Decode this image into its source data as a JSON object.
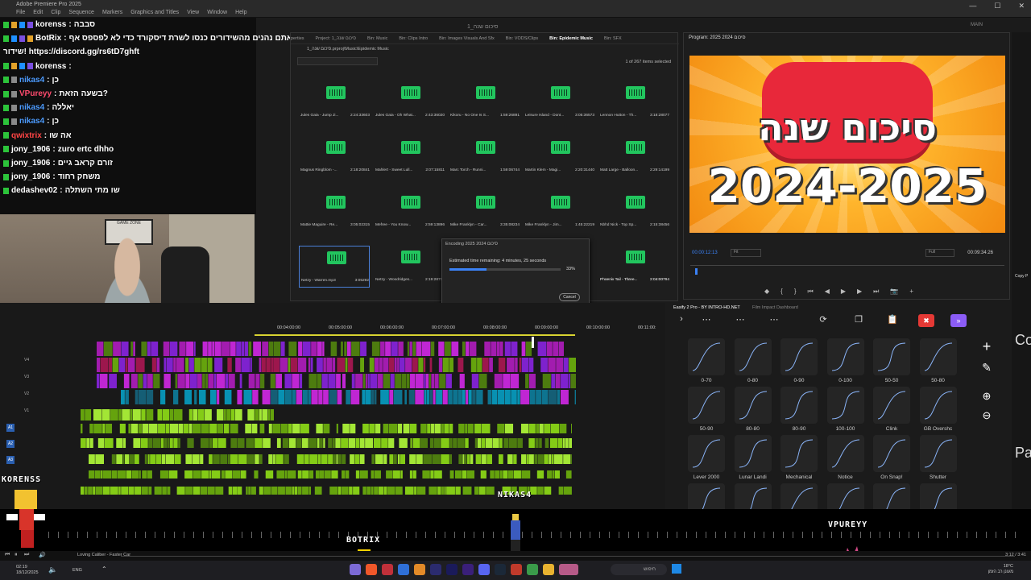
{
  "titlebar": {
    "app": "Adobe Premiere Pro 2025",
    "menus": [
      "File",
      "Edit",
      "Clip",
      "Sequence",
      "Markers",
      "Graphics and Titles",
      "View",
      "Window",
      "Help"
    ],
    "sequence_title": "סיכום שנה_1",
    "workspace": "MAIN"
  },
  "chat": [
    {
      "user": "korenss",
      "color": "#ffffff",
      "text": "סבבה",
      "badges": [
        "green",
        "orange",
        "blue",
        "purple"
      ]
    },
    {
      "user": "BotRix",
      "color": "#ffffff",
      "text": "אם אתם נהנים מהשידורים כנסו לשרת דיסקורד כדי לא לפספס אף",
      "badges": [
        "green",
        "blue",
        "purple",
        "orange"
      ]
    },
    {
      "user": "",
      "color": "#ffffff",
      "text": "שידור! https://discord.gg/rs6tD7ghft",
      "badges": []
    },
    {
      "user": "korenss",
      "color": "#ffffff",
      "text": "",
      "badges": [
        "green",
        "orange",
        "blue",
        "purple"
      ]
    },
    {
      "user": "nikas4",
      "color": "#4c9bff",
      "text": "כן",
      "badges": [
        "green",
        "gray"
      ]
    },
    {
      "user": "VPureyy",
      "color": "#ff4b6e",
      "text": "בשעה הזאת?",
      "badges": [
        "green",
        "gray"
      ]
    },
    {
      "user": "nikas4",
      "color": "#4c9bff",
      "text": "יאללה",
      "badges": [
        "green",
        "gray"
      ]
    },
    {
      "user": "nikas4",
      "color": "#4c9bff",
      "text": "כן",
      "badges": [
        "green",
        "gray"
      ]
    },
    {
      "user": "qwixtrix",
      "color": "#ff4545",
      "text": "אה שו",
      "badges": [
        "green"
      ]
    },
    {
      "user": "jony_1906",
      "color": "#ffffff",
      "text": "zuro ertc dhho",
      "badges": [
        "green"
      ]
    },
    {
      "user": "jony_1906",
      "color": "#ffffff",
      "text": "זורם קראב גיים",
      "badges": [
        "green"
      ]
    },
    {
      "user": "jony_1906",
      "color": "#ffffff",
      "text": "משחק רחוד",
      "badges": [
        "green"
      ]
    },
    {
      "user": "dedashev02",
      "color": "#ffffff",
      "text": "שו מתי השתלה",
      "badges": [
        "green"
      ]
    }
  ],
  "cam": {
    "sign": "GAME ZONE"
  },
  "project": {
    "tabs": [
      "perties",
      "Project: 1_סיכום שנה",
      "Bin: Music",
      "Bin: Clips Intro",
      "Bin: Images Visuals And Sfx",
      "Bin: VODS/Clips",
      "Bin: Epidemic Music",
      "Bin: SFX"
    ],
    "active_tab": "Bin: Epidemic Music",
    "path": "1_סיכום שנה.prproj\\Music\\Epidemic Music",
    "items_count": "1 of 267 items selected",
    "clips": [
      {
        "name": "Jules Gaia - Jump Ji...",
        "dur": "2:24:33603"
      },
      {
        "name": "Jules Gaia - Oh What...",
        "dur": "2:43:36020"
      },
      {
        "name": "Kikoru - No One Is S...",
        "dur": "1:59:26891"
      },
      {
        "name": "Leisure Island - Dont...",
        "dur": "3:05:36573"
      },
      {
        "name": "Lennon Hutton - Th...",
        "dur": "3:18:28077"
      },
      {
        "name": "Magnus Ringblom -...",
        "dur": "2:18:20841"
      },
      {
        "name": "Mahlert - Sweet Lull...",
        "dur": "2:07:15811"
      },
      {
        "name": "Marc Torch - Runni...",
        "dur": "1:59:06744"
      },
      {
        "name": "Martin Klem - Magi...",
        "dur": "2:20:31440"
      },
      {
        "name": "Matt Large - Balloon...",
        "dur": "2:29:14199"
      },
      {
        "name": "Mattie Maguire - Re...",
        "dur": "3:05:02315"
      },
      {
        "name": "Mefree - You Know...",
        "dur": "2:59:13896"
      },
      {
        "name": "Mike Franklyn - Car...",
        "dur": "3:35:08234"
      },
      {
        "name": "Mike Franklyn - Jim...",
        "dur": "1:45:22219"
      },
      {
        "name": "Nbhd Nick - Top Sp...",
        "dur": "2:15:38456"
      },
      {
        "name": "Netzy - Warren.mp3",
        "dur": "3:05292"
      },
      {
        "name": "Netzy - Woodridges...",
        "dur": "2:19:28755"
      },
      {
        "name": "",
        "dur": ""
      },
      {
        "name": "",
        "dur": "4"
      },
      {
        "name": "Phoenix Tail - Three...",
        "dur": "2:04:00794"
      }
    ]
  },
  "encoding": {
    "title": "Encoding 2025 2024 סיכום",
    "estimated": "Estimated time remaining: 4 minutes, 25 seconds",
    "percent_label": "33%",
    "progress": 0.33,
    "cancel": "Cancel"
  },
  "program": {
    "title": "Program: 2025 2024 סיכום",
    "thumb_heb": "סיכום שנה",
    "thumb_year": "2024-2025",
    "current_time": "00:00:12:13",
    "fit": "Fit",
    "full": "Full",
    "duration": "00:09:34:26"
  },
  "timeline": {
    "ruler": [
      "00:04:00:00",
      "00:05:00:00",
      "00:06:00:00",
      "00:07:00:00",
      "00:08:00:00",
      "00:09:00:00",
      "00:10:00:00",
      "00:11:00:"
    ],
    "video_tracks": [
      "V4",
      "V3",
      "V2",
      "V1"
    ],
    "audio_tracks": [
      "A1",
      "A2",
      "A3"
    ]
  },
  "easify": {
    "title": "Easify 2 Pro - BY INTRO-HD.NET",
    "subtitle": "Film Impact Dashboard",
    "presets": [
      "0-70",
      "0-80",
      "0-90",
      "0-100",
      "50-50",
      "50-80",
      "50-90",
      "80-80",
      "80-90",
      "100-100",
      "Clink",
      "GB Overshc",
      "Lever 2000",
      "Lunar Landi",
      "Mechanical",
      "Notice",
      "On Snap!",
      "Shutter"
    ]
  },
  "right_edge": {
    "top": "Copy P",
    "mid1": "Co",
    "mid2": "Pa"
  },
  "overlay": {
    "names": [
      "KORENSS",
      "NIKAS4",
      "BOTRIX",
      "VPUREYY"
    ]
  },
  "player": {
    "track": "Loving Caliber - Faster Car",
    "time": "3:12 / 3:41"
  },
  "taskbar": {
    "time": "02:19",
    "date": "18/12/2025",
    "lang": "ENG",
    "search": "חיפוש",
    "weather_temp": "18°C",
    "weather_text": "מעונן רב הזמן"
  }
}
